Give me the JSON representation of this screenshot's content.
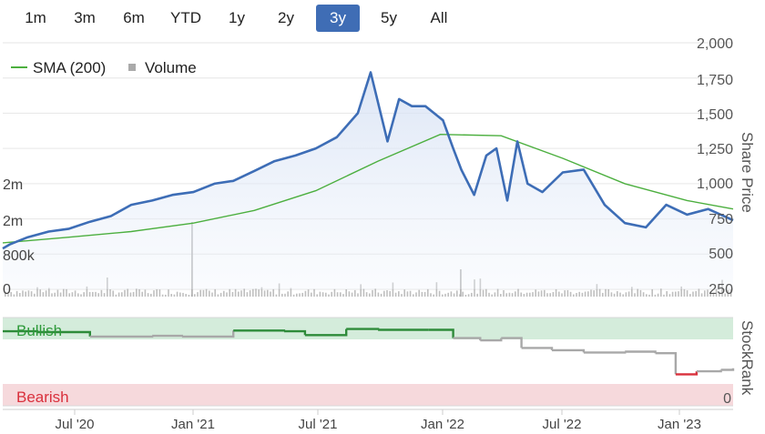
{
  "range_selector": {
    "buttons": [
      "1m",
      "3m",
      "6m",
      "YTD",
      "1y",
      "2y",
      "3y",
      "5y",
      "All"
    ],
    "active": "3y",
    "active_color": "#3f6db5"
  },
  "legend": {
    "sma_label": "SMA (200)",
    "volume_label": "Volume",
    "sma_color": "#4caf3f",
    "volume_color": "#aaaaaa"
  },
  "price_axis": {
    "title": "Share Price",
    "ticks": [
      "2,000",
      "1,750",
      "1,500",
      "1,250",
      "1,000",
      "750",
      "500",
      "250"
    ]
  },
  "volume_axis": {
    "ticks": [
      "2m",
      "2m",
      "800k",
      "0"
    ]
  },
  "stockrank_axis": {
    "title": "StockRank",
    "ticks": [
      "0"
    ],
    "bullish_label": "Bullish",
    "bearish_label": "Bearish",
    "bullish_color": "#2e9a3a",
    "bearish_color": "#d9303c"
  },
  "x_axis": {
    "ticks": [
      "Jul '20",
      "Jan '21",
      "Jul '21",
      "Jan '22",
      "Jul '22",
      "Jan '23"
    ]
  },
  "chart_data": {
    "type": "line",
    "price_series": {
      "name": "Share Price",
      "color": "#3d6db6",
      "x": [
        "2020-03-25",
        "2020-04-05",
        "2020-05-01",
        "2020-06-01",
        "2020-07-01",
        "2020-08-01",
        "2020-09-01",
        "2020-10-01",
        "2020-11-01",
        "2020-12-01",
        "2021-01-01",
        "2021-02-01",
        "2021-03-01",
        "2021-04-01",
        "2021-05-01",
        "2021-06-01",
        "2021-07-01",
        "2021-08-01",
        "2021-09-01",
        "2021-09-20",
        "2021-10-15",
        "2021-11-01",
        "2021-11-20",
        "2021-12-10",
        "2022-01-05",
        "2022-01-20",
        "2022-02-01",
        "2022-02-20",
        "2022-03-10",
        "2022-03-25",
        "2022-04-10",
        "2022-04-25",
        "2022-05-10",
        "2022-06-01",
        "2022-07-01",
        "2022-08-01",
        "2022-09-01",
        "2022-10-01",
        "2022-11-01",
        "2022-12-01",
        "2023-01-01",
        "2023-02-01",
        "2023-03-10"
      ],
      "y": [
        540,
        570,
        620,
        660,
        680,
        730,
        770,
        850,
        880,
        920,
        940,
        1000,
        1020,
        1090,
        1160,
        1200,
        1250,
        1330,
        1500,
        1790,
        1300,
        1600,
        1550,
        1550,
        1450,
        1250,
        1100,
        920,
        1200,
        1250,
        880,
        1300,
        1000,
        940,
        1080,
        1100,
        850,
        720,
        690,
        850,
        780,
        820,
        740
      ]
    },
    "sma_series": {
      "name": "SMA (200)",
      "x": [
        "2020-03-25",
        "2020-07-01",
        "2020-10-01",
        "2021-01-01",
        "2021-04-01",
        "2021-07-01",
        "2021-10-01",
        "2022-01-01",
        "2022-04-01",
        "2022-07-01",
        "2022-10-01",
        "2023-01-01",
        "2023-03-10"
      ],
      "y": [
        580,
        620,
        660,
        720,
        810,
        950,
        1160,
        1350,
        1340,
        1180,
        1000,
        880,
        820
      ]
    },
    "volume_series": {
      "name": "Volume",
      "peak_labels": [
        "Jan '21",
        "Jan '22"
      ]
    },
    "stockrank_series": {
      "name": "StockRank",
      "x": [
        "2020-03-25",
        "2020-05-15",
        "2020-08-01",
        "2020-11-01",
        "2020-12-15",
        "2021-03-01",
        "2021-05-15",
        "2021-06-15",
        "2021-08-15",
        "2021-10-01",
        "2021-12-15",
        "2022-01-20",
        "2022-03-01",
        "2022-04-01",
        "2022-05-01",
        "2022-06-15",
        "2022-08-01",
        "2022-10-01",
        "2022-11-15",
        "2022-12-15",
        "2023-01-15",
        "2023-02-20",
        "2023-03-10"
      ],
      "y": [
        89,
        88,
        82,
        83,
        82,
        90,
        89,
        84,
        92,
        91,
        91,
        80,
        77,
        80,
        67,
        64,
        61,
        62,
        60,
        32,
        36,
        38,
        40
      ]
    },
    "price_ylim": [
      250,
      2000
    ],
    "stockrank_ylim": [
      0,
      100
    ],
    "xlim": [
      "2020-03-25",
      "2023-03-10"
    ],
    "grid": true,
    "legend_position": "top-left"
  }
}
